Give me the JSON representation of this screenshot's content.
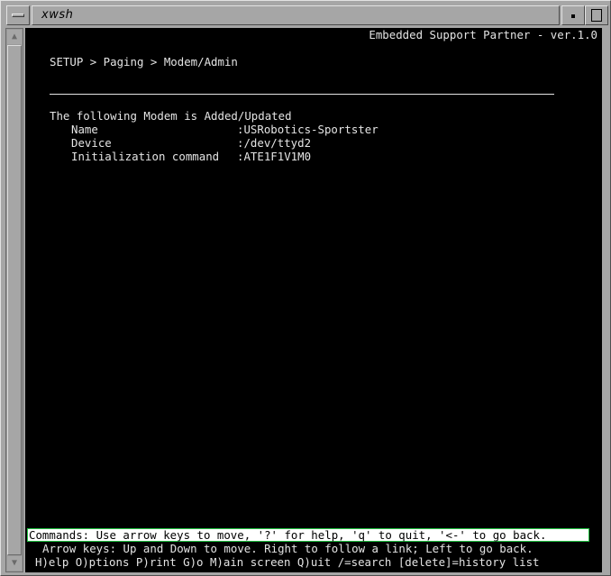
{
  "window": {
    "title": "xwsh"
  },
  "terminal": {
    "header": "Embedded Support Partner - ver.1.0",
    "breadcrumb": "SETUP > Paging > Modem/Admin",
    "message": "The following Modem is Added/Updated",
    "fields": [
      {
        "label": "Name",
        "value": ":USRobotics-Sportster"
      },
      {
        "label": "Device",
        "value": ":/dev/ttyd2"
      },
      {
        "label": "Initialization command",
        "value": ":ATE1F1V1M0"
      }
    ],
    "commands": "Commands: Use arrow keys to move, '?' for help, 'q' to quit, '<-' to go back.",
    "help_line_1": "Arrow keys: Up and Down to move. Right to follow a link; Left to go back.",
    "help_line_2": "H)elp O)ptions P)rint G)o M)ain screen Q)uit /=search [delete]=history list"
  },
  "icons": {
    "window_menu": "window-menu-icon",
    "minimize": "minimize-icon",
    "maximize": "maximize-icon",
    "scroll_up": "scroll-up-arrow-icon",
    "scroll_down": "scroll-down-arrow-icon"
  },
  "colors": {
    "frame": "#a6a6a6",
    "terminal_bg": "#000000",
    "terminal_fg": "#e4e4e4",
    "command_bar_bg": "#ffffff",
    "command_bar_border": "#20c040"
  }
}
